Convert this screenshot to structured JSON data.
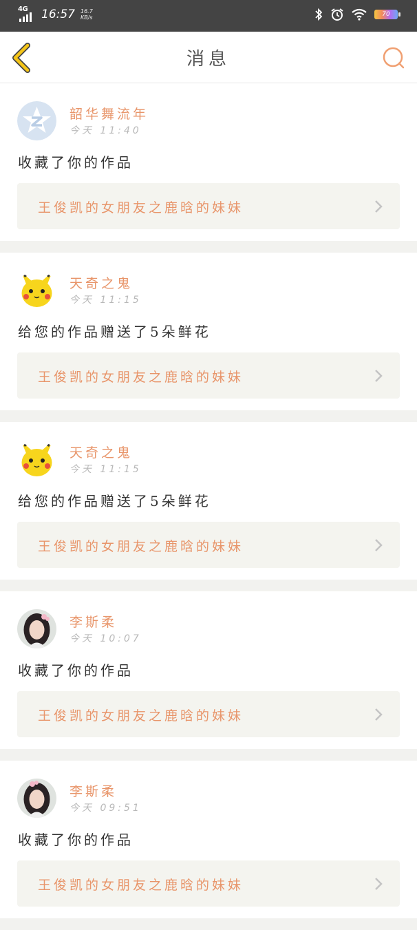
{
  "status_bar": {
    "network": "4G",
    "time": "16:57",
    "speed_value": "16.7",
    "speed_unit": "KB/s",
    "battery": "70"
  },
  "header": {
    "title": "消息"
  },
  "messages": [
    {
      "username": "韶华舞流年",
      "time": "今天  11:40",
      "action": "收藏了你的作品",
      "work_title": "王俊凯的女朋友之鹿晗的妹妹",
      "avatar_icon": "qzone-avatar"
    },
    {
      "username": "天奇之鬼",
      "time": "今天  11:15",
      "action": "给您的作品赠送了5朵鲜花",
      "work_title": "王俊凯的女朋友之鹿晗的妹妹",
      "avatar_icon": "pikachu-avatar"
    },
    {
      "username": "天奇之鬼",
      "time": "今天  11:15",
      "action": "给您的作品赠送了5朵鲜花",
      "work_title": "王俊凯的女朋友之鹿晗的妹妹",
      "avatar_icon": "pikachu-avatar"
    },
    {
      "username": "李斯柔",
      "time": "今天  10:07",
      "action": "收藏了你的作品",
      "work_title": "王俊凯的女朋友之鹿晗的妹妹",
      "avatar_icon": "photo-avatar"
    },
    {
      "username": "李斯柔",
      "time": "今天  09:51",
      "action": "收藏了你的作品",
      "work_title": "王俊凯的女朋友之鹿晗的妹妹",
      "avatar_icon": "photo-avatar"
    }
  ],
  "colors": {
    "accent": "#e8956a",
    "back_arrow": "#f5c518",
    "statusbar_bg": "#444444",
    "page_bg": "#f2f2ef"
  }
}
